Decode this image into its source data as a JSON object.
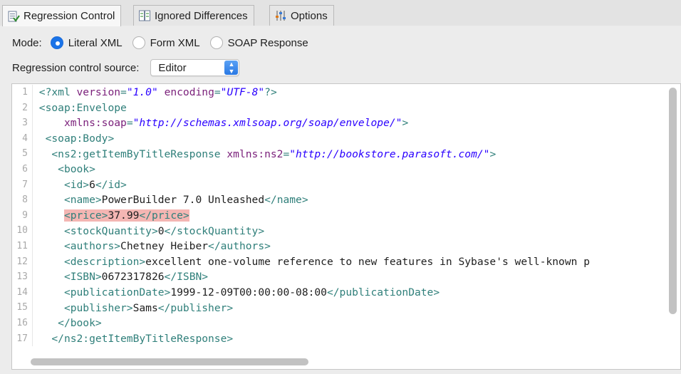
{
  "tabs": [
    {
      "label": "Regression Control",
      "icon": "regression-control-icon",
      "active": true
    },
    {
      "label": "Ignored Differences",
      "icon": "ignored-differences-icon",
      "active": false
    },
    {
      "label": "Options",
      "icon": "options-sliders-icon",
      "active": false
    }
  ],
  "mode": {
    "label": "Mode:",
    "options": [
      {
        "label": "Literal XML",
        "checked": true
      },
      {
        "label": "Form XML",
        "checked": false
      },
      {
        "label": "SOAP Response",
        "checked": false
      }
    ]
  },
  "source": {
    "label": "Regression control source:",
    "selected": "Editor"
  },
  "colors": {
    "accent": "#1a73e8",
    "tag": "#2f7f7a",
    "attribute": "#7a1f7a",
    "string": "#2a00ff",
    "highlight": "#f4b6b3"
  },
  "editor": {
    "line_numbers": [
      "1",
      "2",
      "3",
      "4",
      "5",
      "6",
      "7",
      "8",
      "9",
      "10",
      "11",
      "12",
      "13",
      "14",
      "15",
      "16",
      "17"
    ],
    "lines": [
      {
        "parts": [
          [
            "tg",
            "<?xml "
          ],
          [
            "at",
            "version"
          ],
          [
            "tg",
            "="
          ],
          [
            "st",
            "\"1.0\""
          ],
          [
            "tg",
            " "
          ],
          [
            "at",
            "encoding"
          ],
          [
            "tg",
            "="
          ],
          [
            "st",
            "\"UTF-8\""
          ],
          [
            "tg",
            "?>"
          ]
        ]
      },
      {
        "parts": [
          [
            "tg",
            "<soap:Envelope"
          ]
        ]
      },
      {
        "parts": [
          [
            "tg",
            "    "
          ],
          [
            "at",
            "xmlns:soap"
          ],
          [
            "tg",
            "="
          ],
          [
            "st",
            "\"http://schemas.xmlsoap.org/soap/envelope/\""
          ],
          [
            "tg",
            ">"
          ]
        ]
      },
      {
        "parts": [
          [
            "tg",
            " <soap:Body>"
          ]
        ]
      },
      {
        "parts": [
          [
            "tg",
            "  <ns2:getItemByTitleResponse "
          ],
          [
            "at",
            "xmlns:ns2"
          ],
          [
            "tg",
            "="
          ],
          [
            "st",
            "\"http://bookstore.parasoft.com/\""
          ],
          [
            "tg",
            ">"
          ]
        ]
      },
      {
        "parts": [
          [
            "tg",
            "   <book>"
          ]
        ]
      },
      {
        "parts": [
          [
            "tg",
            "    <id>"
          ],
          [
            "tx",
            "6"
          ],
          [
            "tg",
            "</id>"
          ]
        ]
      },
      {
        "parts": [
          [
            "tg",
            "    <name>"
          ],
          [
            "tx",
            "PowerBuilder 7.0 Unleashed"
          ],
          [
            "tg",
            "</name>"
          ]
        ]
      },
      {
        "highlight": true,
        "indent": "    ",
        "parts": [
          [
            "tg",
            "<price>"
          ],
          [
            "tx",
            "37.99"
          ],
          [
            "tg",
            "</price>"
          ]
        ]
      },
      {
        "parts": [
          [
            "tg",
            "    <stockQuantity>"
          ],
          [
            "tx",
            "0"
          ],
          [
            "tg",
            "</stockQuantity>"
          ]
        ]
      },
      {
        "parts": [
          [
            "tg",
            "    <authors>"
          ],
          [
            "tx",
            "Chetney Heiber"
          ],
          [
            "tg",
            "</authors>"
          ]
        ]
      },
      {
        "parts": [
          [
            "tg",
            "    <description>"
          ],
          [
            "tx",
            "excellent one-volume reference to new features in Sybase's well-known p"
          ]
        ]
      },
      {
        "parts": [
          [
            "tg",
            "    <ISBN>"
          ],
          [
            "tx",
            "0672317826"
          ],
          [
            "tg",
            "</ISBN>"
          ]
        ]
      },
      {
        "parts": [
          [
            "tg",
            "    <publicationDate>"
          ],
          [
            "tx",
            "1999-12-09T00:00:00-08:00"
          ],
          [
            "tg",
            "</publicationDate>"
          ]
        ]
      },
      {
        "parts": [
          [
            "tg",
            "    <publisher>"
          ],
          [
            "tx",
            "Sams"
          ],
          [
            "tg",
            "</publisher>"
          ]
        ]
      },
      {
        "parts": [
          [
            "tg",
            "   </book>"
          ]
        ]
      },
      {
        "parts": [
          [
            "tg",
            "  </ns2:getItemByTitleResponse>"
          ]
        ]
      }
    ]
  }
}
